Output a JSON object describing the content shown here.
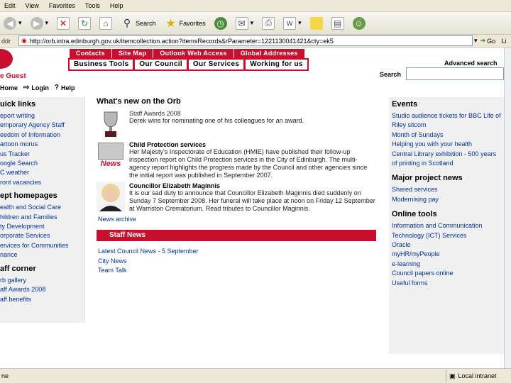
{
  "browser": {
    "menu": [
      "Edit",
      "View",
      "Favorites",
      "Tools",
      "Help"
    ],
    "toolbar": {
      "search_label": "Search",
      "favorites_label": "Favorites"
    },
    "address": {
      "label": "ddr",
      "url": "http://orb.intra.edinburgh.gov.uk/itemcollection.action?itemsRecords&rParameter=1221130041421&cty=ek5",
      "go_label": "Go",
      "links_label": "Li"
    },
    "status": {
      "left_text": "ne",
      "zone_label": "Local intranet"
    }
  },
  "header": {
    "top_nav": [
      "Contacts",
      "Site Map",
      "Outlook Web Access",
      "Global Addresses"
    ],
    "main_nav": [
      "Business Tools",
      "Our Council",
      "Our Services",
      "Working for us"
    ],
    "guest_text": "e Guest",
    "advanced_search": "Advanced search",
    "search_label": "Search",
    "search_value": "",
    "util_links": [
      "Home",
      "Login",
      "Help"
    ]
  },
  "left": {
    "quick_links_title": "uick links",
    "quick_links": [
      "eport writing",
      "emporary Agency Staff",
      "eedom of Information",
      "artoon morus",
      "us Tracker",
      "oogle Search",
      "C weather",
      "ront vacancies"
    ],
    "dept_title": "ept homepages",
    "dept_links": [
      "ealth and Social Care",
      "hildren and Families",
      "ty Development",
      "orporate Services",
      "ervices for Communities",
      "nance"
    ],
    "staff_corner_title": "aff corner",
    "staff_corner_links": [
      "rb gallery",
      "aff Awards 2008",
      "aff benefits"
    ]
  },
  "center": {
    "title": "What's new on the Orb",
    "news": [
      {
        "title": "Staff Awards 2008",
        "body": "Derek wins for nominating one of his colleagues for an award."
      },
      {
        "title": "Child Protection services",
        "body": "Her Majesty's Inspectorate of Education (HMIE) have published their follow-up inspection report on Child Protection services in the City of Edinburgh. The multi-agency report highlights the progress made by the Council and other agencies since the initial report was published in September 2007.",
        "badge": "News"
      },
      {
        "title": "Councillor Elizabeth Maginnis",
        "body": "It is our sad duty to announce that Councillor Elizabeth Maginnis died suddenly on Sunday 7 September 2008. Her funeral will take place at noon on Friday 12 September at Warriston Crematorium. Read tributes to Councillor Maginnis."
      }
    ],
    "archive": "News archive",
    "staff_news_title": "Staff News",
    "staff_news": [
      "Latest Council News - 5 September",
      "City News",
      "Team Talk"
    ]
  },
  "right": {
    "events_title": "Events",
    "events": [
      "Studio audience tickets for BBC Life of Riley sitcom",
      "Month of Sundays",
      "Helping you with your health",
      "Central Library exhibition - 500 years of printing in Scotland"
    ],
    "projects_title": "Major project news",
    "projects": [
      "Shared services",
      "Modernising pay"
    ],
    "tools_title": "Online tools",
    "tools": [
      "Information and Communication Technology (ICT) Services",
      "Oracle",
      "myHR/myPeople",
      "e-learning",
      "Council papers online",
      "Useful forms"
    ]
  },
  "colors": {
    "brand_red": "#c8102e",
    "link_blue": "#0033a0"
  }
}
